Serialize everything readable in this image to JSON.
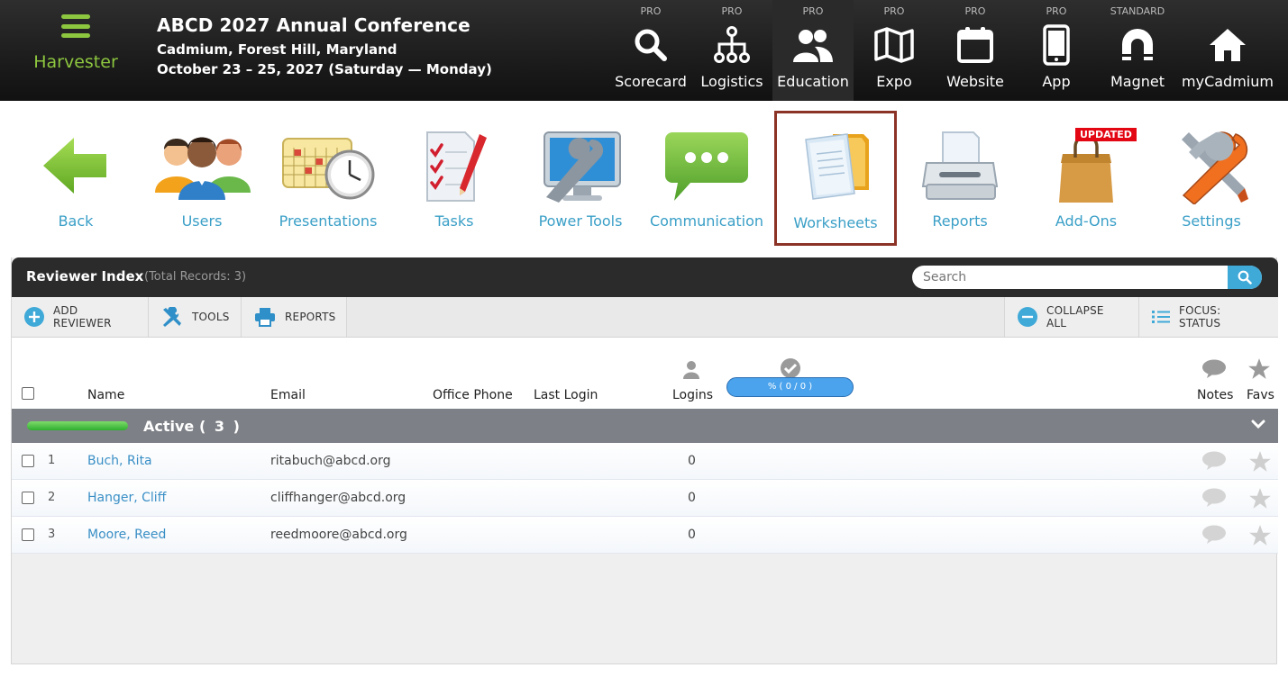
{
  "header": {
    "app_name": "Harvester",
    "conference_title": "ABCD 2027 Annual Conference",
    "location": "Cadmium, Forest Hill, Maryland",
    "dates": "October 23 – 25, 2027 (Saturday — Monday)"
  },
  "modules": [
    {
      "tier": "PRO",
      "label": "Scorecard",
      "icon": "search-icon"
    },
    {
      "tier": "PRO",
      "label": "Logistics",
      "icon": "network-icon"
    },
    {
      "tier": "PRO",
      "label": "Education",
      "icon": "people-icon",
      "active": true
    },
    {
      "tier": "PRO",
      "label": "Expo",
      "icon": "map-icon"
    },
    {
      "tier": "PRO",
      "label": "Website",
      "icon": "calendar-icon"
    },
    {
      "tier": "PRO",
      "label": "App",
      "icon": "phone-icon"
    },
    {
      "tier": "STANDARD",
      "label": "Magnet",
      "icon": "magnet-icon"
    },
    {
      "tier": "",
      "label": "myCadmium",
      "icon": "home-icon"
    }
  ],
  "toolbar": [
    {
      "label": "Back",
      "icon": "back-arrow-icon"
    },
    {
      "label": "Users",
      "icon": "users-icon"
    },
    {
      "label": "Presentations",
      "icon": "calendar-clock-icon"
    },
    {
      "label": "Tasks",
      "icon": "checklist-icon"
    },
    {
      "label": "Power Tools",
      "icon": "monitor-wrench-icon"
    },
    {
      "label": "Communication",
      "icon": "chat-bubble-icon"
    },
    {
      "label": "Worksheets",
      "icon": "folder-documents-icon",
      "selected": true
    },
    {
      "label": "Reports",
      "icon": "printer-icon"
    },
    {
      "label": "Add-Ons",
      "icon": "shopping-bag-icon",
      "badge": "UPDATED"
    },
    {
      "label": "Settings",
      "icon": "tools-icon"
    }
  ],
  "panel": {
    "title": "Reviewer Index",
    "total": "(Total Records: 3)",
    "search_placeholder": "Search"
  },
  "actions": {
    "add_reviewer": "ADD REVIEWER",
    "tools": "TOOLS",
    "reports": "REPORTS",
    "collapse_all": "COLLAPSE ALL",
    "focus_status": "FOCUS: STATUS"
  },
  "columns": {
    "name": "Name",
    "email": "Email",
    "office_phone": "Office Phone",
    "last_login": "Last Login",
    "logins": "Logins",
    "progress": "% ( 0 / 0 )",
    "notes": "Notes",
    "favs": "Favs"
  },
  "group": {
    "label": "Active",
    "count": "( 3 )"
  },
  "rows": [
    {
      "num": "1",
      "name": "Buch, Rita",
      "email": "ritabuch@abcd.org",
      "logins": "0"
    },
    {
      "num": "2",
      "name": "Hanger, Cliff",
      "email": "cliffhanger@abcd.org",
      "logins": "0"
    },
    {
      "num": "3",
      "name": "Moore, Reed",
      "email": "reedmoore@abcd.org",
      "logins": "0"
    }
  ]
}
